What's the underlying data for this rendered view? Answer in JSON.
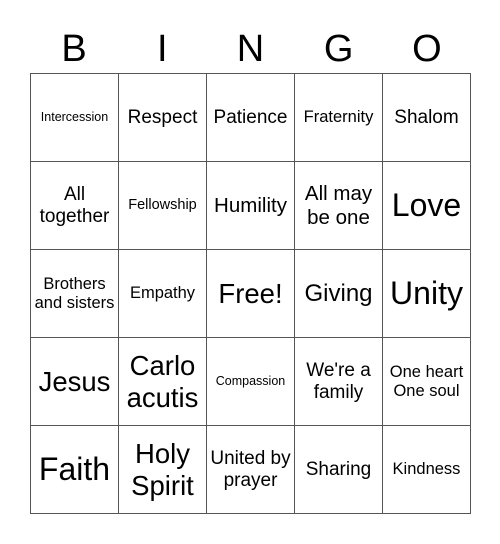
{
  "header": {
    "letters": [
      "B",
      "I",
      "N",
      "G",
      "O"
    ]
  },
  "cells": [
    [
      "Intercession",
      "Respect",
      "Patience",
      "Fraternity",
      "Shalom"
    ],
    [
      "All together",
      "Fellowship",
      "Humility",
      "All may be one",
      "Love"
    ],
    [
      "Brothers and sisters",
      "Empathy",
      "Free!",
      "Giving",
      "Unity"
    ],
    [
      "Jesus",
      "Carlo acutis",
      "Compassion",
      "We're a family",
      "One heart One soul"
    ],
    [
      "Faith",
      "Holy Spirit",
      "United by prayer",
      "Sharing",
      "Kindness"
    ]
  ]
}
